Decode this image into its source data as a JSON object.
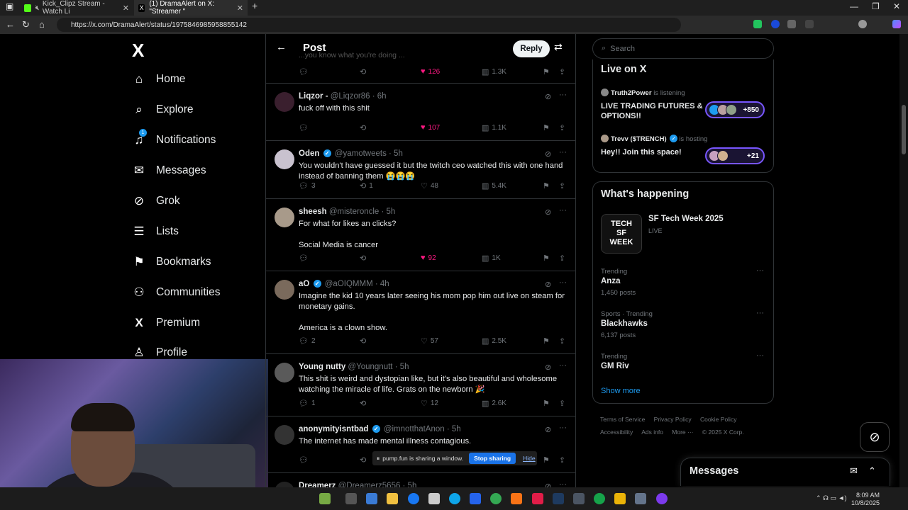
{
  "browser": {
    "tabs": [
      {
        "title": "Kick_Clipz Stream - Watch Li",
        "active": false
      },
      {
        "title": "(1) DramaAlert on X: \"Streamer \"",
        "active": true
      }
    ],
    "new_tab": "+",
    "url": "https://x.com/DramaAlert/status/1975846985958855142"
  },
  "nav": {
    "logo": "X",
    "items": [
      {
        "label": "Home",
        "icon": "home-icon",
        "glyph": "⌂"
      },
      {
        "label": "Explore",
        "icon": "search-icon",
        "glyph": "⌕"
      },
      {
        "label": "Notifications",
        "icon": "bell-icon",
        "glyph": "🔔︎"
      },
      {
        "label": "Messages",
        "icon": "mail-icon",
        "glyph": "✉"
      },
      {
        "label": "Grok",
        "icon": "grok-icon",
        "glyph": "⊘"
      },
      {
        "label": "Lists",
        "icon": "list-icon",
        "glyph": "☰"
      },
      {
        "label": "Bookmarks",
        "icon": "bookmark-icon",
        "glyph": "⚑"
      },
      {
        "label": "Communities",
        "icon": "communities-icon",
        "glyph": "⚇"
      },
      {
        "label": "Premium",
        "icon": "x-icon",
        "glyph": "X"
      },
      {
        "label": "Profile",
        "icon": "profile-icon",
        "glyph": "♙"
      }
    ],
    "notification_badge": "1"
  },
  "post_header": {
    "title": "Post",
    "reply_label": "Reply"
  },
  "tweets": [
    {
      "name": "Liqzor -",
      "handle": "@Liqzor86 · 6h",
      "verified": false,
      "text": "fuck off with this shit",
      "replies": "",
      "reposts": "",
      "likes": "107",
      "liked": true,
      "views": "1.1K",
      "avatar_color": "#3a1f2e"
    },
    {
      "name": "Oden",
      "handle": "@yamotweets · 5h",
      "verified": true,
      "text": "You wouldn't have guessed it but the twitch ceo watched this with one hand instead of banning them 😭😭😭",
      "replies": "3",
      "reposts": "1",
      "likes": "48",
      "liked": false,
      "views": "5.4K",
      "avatar_color": "#c9c2cf"
    },
    {
      "name": "sheesh",
      "handle": "@misteroncle · 5h",
      "verified": false,
      "text": "For what for likes an clicks?\n\nSocial Media is cancer",
      "replies": "",
      "reposts": "",
      "likes": "92",
      "liked": true,
      "views": "1K",
      "avatar_color": "#a89a8a"
    },
    {
      "name": "aO",
      "handle": "@aOIQMMM · 4h",
      "verified": true,
      "text": "Imagine the kid 10 years later seeing his mom pop him out live on steam for monetary gains.\n\nAmerica is a clown show.",
      "replies": "2",
      "reposts": "",
      "likes": "57",
      "liked": false,
      "views": "2.5K",
      "avatar_color": "#7a6a5c"
    },
    {
      "name": "Young nutty",
      "handle": "@Youngnutt · 5h",
      "verified": false,
      "text": "This shit is weird and dystopian like, but it's also beautiful and wholesome watching the miracle of life. Grats on the newborn 🎉",
      "replies": "1",
      "reposts": "",
      "likes": "12",
      "liked": false,
      "views": "2.6K",
      "avatar_color": "#5a5a5a"
    },
    {
      "name": "anonymityisntbad",
      "handle": "@imnotthatAnon · 5h",
      "verified": true,
      "text": "The internet has made mental illness contagious.",
      "replies": "",
      "reposts": "",
      "likes": "",
      "liked": false,
      "views": "",
      "avatar_color": "#333"
    },
    {
      "name": "Dreamerz",
      "handle": "@Dreamerz5656 · 5h",
      "verified": false,
      "text": "",
      "replies": "",
      "reposts": "",
      "likes": "",
      "liked": false,
      "views": "",
      "avatar_color": "#222"
    }
  ],
  "top_partial": {
    "likes": "126",
    "views": "1.3K",
    "ghost_text": "...you know what you're doing ..."
  },
  "screen_share": {
    "text": "pump.fun is sharing a window.",
    "stop": "Stop sharing",
    "hide": "Hide"
  },
  "right": {
    "search_placeholder": "Search",
    "live": {
      "title": "Live on X",
      "spaces": [
        {
          "host": "Truth2Power",
          "status": "is listening",
          "title": "LIVE TRADING FUTURES & OPTIONS!!",
          "count": "+850"
        },
        {
          "host": "Trevv ($TRENCH)",
          "status": "is hosting",
          "title": "Hey!! Join this space!",
          "count": "+21"
        }
      ]
    },
    "happening": {
      "title": "What's happening",
      "event": {
        "name": "SF Tech Week 2025",
        "status": "LIVE",
        "thumb_text": "TECH\nSF WEEK"
      },
      "trends": [
        {
          "meta": "Trending",
          "name": "Anza",
          "posts": "1,450 posts"
        },
        {
          "meta": "Sports · Trending",
          "name": "Blackhawks",
          "posts": "6,137 posts"
        },
        {
          "meta": "Trending",
          "name": "GM Riv",
          "posts": ""
        }
      ],
      "show_more": "Show more"
    },
    "footer": [
      "Terms of Service",
      "Privacy Policy",
      "Cookie Policy",
      "Accessibility",
      "Ads info",
      "More ···",
      "© 2025 X Corp."
    ],
    "messages_dock": "Messages"
  },
  "taskbar": {
    "time": "8:09 AM",
    "date": "10/8/2025"
  }
}
